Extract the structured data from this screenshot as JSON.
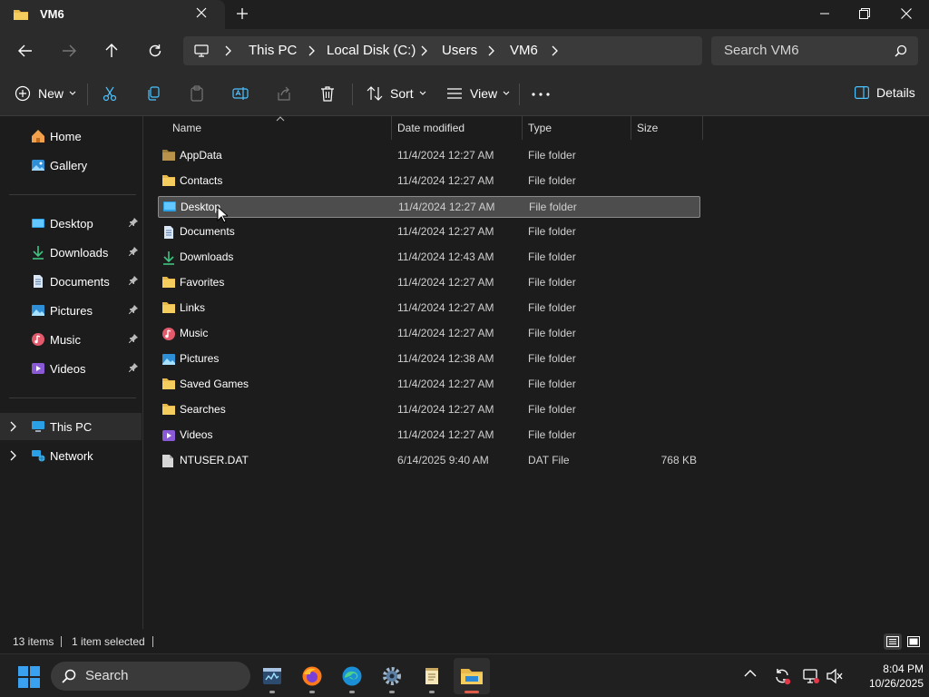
{
  "window": {
    "tab_title": "VM6",
    "new_tab_symbol": "+"
  },
  "navigation": {
    "breadcrumb": [
      "This PC",
      "Local Disk (C:)",
      "Users",
      "VM6"
    ],
    "search_placeholder": "Search VM6"
  },
  "commandbar": {
    "new_label": "New",
    "sort_label": "Sort",
    "view_label": "View",
    "details_label": "Details"
  },
  "sidebar": {
    "top": [
      {
        "label": "Home",
        "icon": "home-icon"
      },
      {
        "label": "Gallery",
        "icon": "gallery-icon"
      }
    ],
    "pinned": [
      {
        "label": "Desktop",
        "icon": "desktop-folder-icon"
      },
      {
        "label": "Downloads",
        "icon": "downloads-folder-icon"
      },
      {
        "label": "Documents",
        "icon": "documents-folder-icon"
      },
      {
        "label": "Pictures",
        "icon": "pictures-folder-icon"
      },
      {
        "label": "Music",
        "icon": "music-folder-icon"
      },
      {
        "label": "Videos",
        "icon": "videos-folder-icon"
      }
    ],
    "tree": [
      {
        "label": "This PC",
        "icon": "this-pc-icon"
      },
      {
        "label": "Network",
        "icon": "network-icon"
      }
    ]
  },
  "columns": {
    "name": "Name",
    "date": "Date modified",
    "type": "Type",
    "size": "Size"
  },
  "files": [
    {
      "name": "AppData",
      "date": "11/4/2024 12:27 AM",
      "type": "File folder",
      "size": "",
      "icon": "folder-dim"
    },
    {
      "name": "Contacts",
      "date": "11/4/2024 12:27 AM",
      "type": "File folder",
      "size": "",
      "icon": "folder"
    },
    {
      "name": "Desktop",
      "date": "11/4/2024 12:27 AM",
      "type": "File folder",
      "size": "",
      "icon": "desktop"
    },
    {
      "name": "Documents",
      "date": "11/4/2024 12:27 AM",
      "type": "File folder",
      "size": "",
      "icon": "documents"
    },
    {
      "name": "Downloads",
      "date": "11/4/2024 12:43 AM",
      "type": "File folder",
      "size": "",
      "icon": "downloads"
    },
    {
      "name": "Favorites",
      "date": "11/4/2024 12:27 AM",
      "type": "File folder",
      "size": "",
      "icon": "folder"
    },
    {
      "name": "Links",
      "date": "11/4/2024 12:27 AM",
      "type": "File folder",
      "size": "",
      "icon": "folder"
    },
    {
      "name": "Music",
      "date": "11/4/2024 12:27 AM",
      "type": "File folder",
      "size": "",
      "icon": "music"
    },
    {
      "name": "Pictures",
      "date": "11/4/2024 12:38 AM",
      "type": "File folder",
      "size": "",
      "icon": "pictures"
    },
    {
      "name": "Saved Games",
      "date": "11/4/2024 12:27 AM",
      "type": "File folder",
      "size": "",
      "icon": "folder"
    },
    {
      "name": "Searches",
      "date": "11/4/2024 12:27 AM",
      "type": "File folder",
      "size": "",
      "icon": "folder"
    },
    {
      "name": "Videos",
      "date": "11/4/2024 12:27 AM",
      "type": "File folder",
      "size": "",
      "icon": "videos"
    },
    {
      "name": "NTUSER.DAT",
      "date": "6/14/2025 9:40 AM",
      "type": "DAT File",
      "size": "768 KB",
      "icon": "file"
    }
  ],
  "selected_index": 2,
  "status": {
    "item_count": "13 items",
    "selection": "1 item selected"
  },
  "taskbar": {
    "search_label": "Search",
    "time": "8:04 PM",
    "date": "10/26/2025"
  },
  "colors": {
    "folder": "#e8b84a",
    "accent": "#4cc2ff",
    "selection": "#4d4d4d"
  }
}
